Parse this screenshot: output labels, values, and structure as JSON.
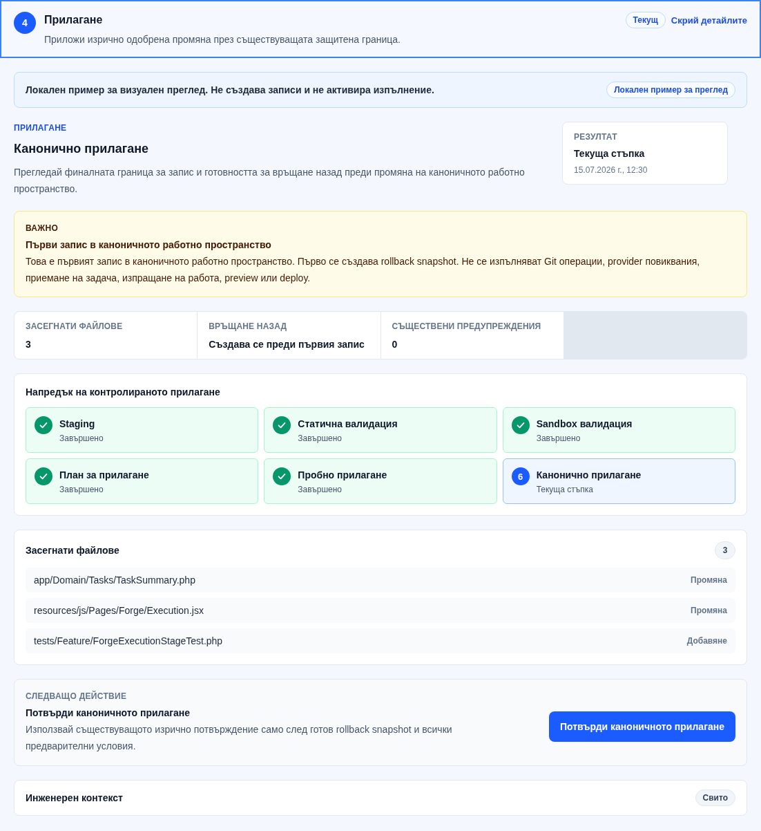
{
  "header": {
    "number": "4",
    "title": "Прилагане",
    "description": "Приложи изрично одобрена промяна през съществуващата защитена граница.",
    "selected": true,
    "badge": "Текущ",
    "toggle_link": "Скрий детайлите"
  },
  "notice": {
    "text": "Локален пример за визуален преглед. Не създава записи и не активира изпълнение.",
    "badge": "Локален пример за преглед"
  },
  "intro": {
    "eyebrow": "ПРИЛАГАНЕ",
    "title": "Канонично прилагане",
    "description": "Прегледай финалната граница за запис и готовността за връщане назад преди промяна на каноничното работно пространство."
  },
  "result": {
    "label": "РЕЗУЛТАТ",
    "value": "Текуща стъпка",
    "timestamp": "15.07.2026 г., 12:30"
  },
  "warning": {
    "label": "ВАЖНО",
    "title": "Първи запис в каноничното работно пространство",
    "text": "Това е първият запис в каноничното работно пространство. Първо се създава rollback snapshot. Не се изпълняват Git операции, provider повиквания, приемане на задача, изпращане на работа, preview или deploy."
  },
  "stats": [
    {
      "label": "ЗАСЕГНАТИ ФАЙЛОВЕ",
      "value": "3"
    },
    {
      "label": "ВРЪЩАНЕ НАЗАД",
      "value": "Създава се преди първия запис"
    },
    {
      "label": "СЪЩЕСТВЕНИ ПРЕДУПРЕЖДЕНИЯ",
      "value": "0"
    }
  ],
  "progress": {
    "title": "Напредък на контролираното прилагане",
    "steps": [
      {
        "kind": "done",
        "title": "Staging",
        "status": "Завършено"
      },
      {
        "kind": "done",
        "title": "Статична валидация",
        "status": "Завършено"
      },
      {
        "kind": "done",
        "title": "Sandbox валидация",
        "status": "Завършено"
      },
      {
        "kind": "done",
        "title": "План за прилагане",
        "status": "Завършено"
      },
      {
        "kind": "done",
        "title": "Пробно прилагане",
        "status": "Завършено"
      },
      {
        "kind": "current",
        "number": "6",
        "title": "Канонично прилагане",
        "status": "Текуща стъпка"
      }
    ]
  },
  "files": {
    "title": "Засегнати файлове",
    "count": "3",
    "rows": [
      {
        "path": "app/Domain/Tasks/TaskSummary.php",
        "change": "Промяна"
      },
      {
        "path": "resources/js/Pages/Forge/Execution.jsx",
        "change": "Промяна"
      },
      {
        "path": "tests/Feature/ForgeExecutionStageTest.php",
        "change": "Добавяне"
      }
    ]
  },
  "next_action": {
    "eyebrow": "СЛЕДВАЩО ДЕЙСТВИЕ",
    "title": "Потвърди каноничното прилагане",
    "description": "Използвай съществуващото изрично потвърждение само след готов rollback snapshot и всички предварителни условия.",
    "button": "Потвърди каноничното прилагане"
  },
  "context": {
    "title": "Инженерен контекст",
    "badge": "Свито"
  }
}
